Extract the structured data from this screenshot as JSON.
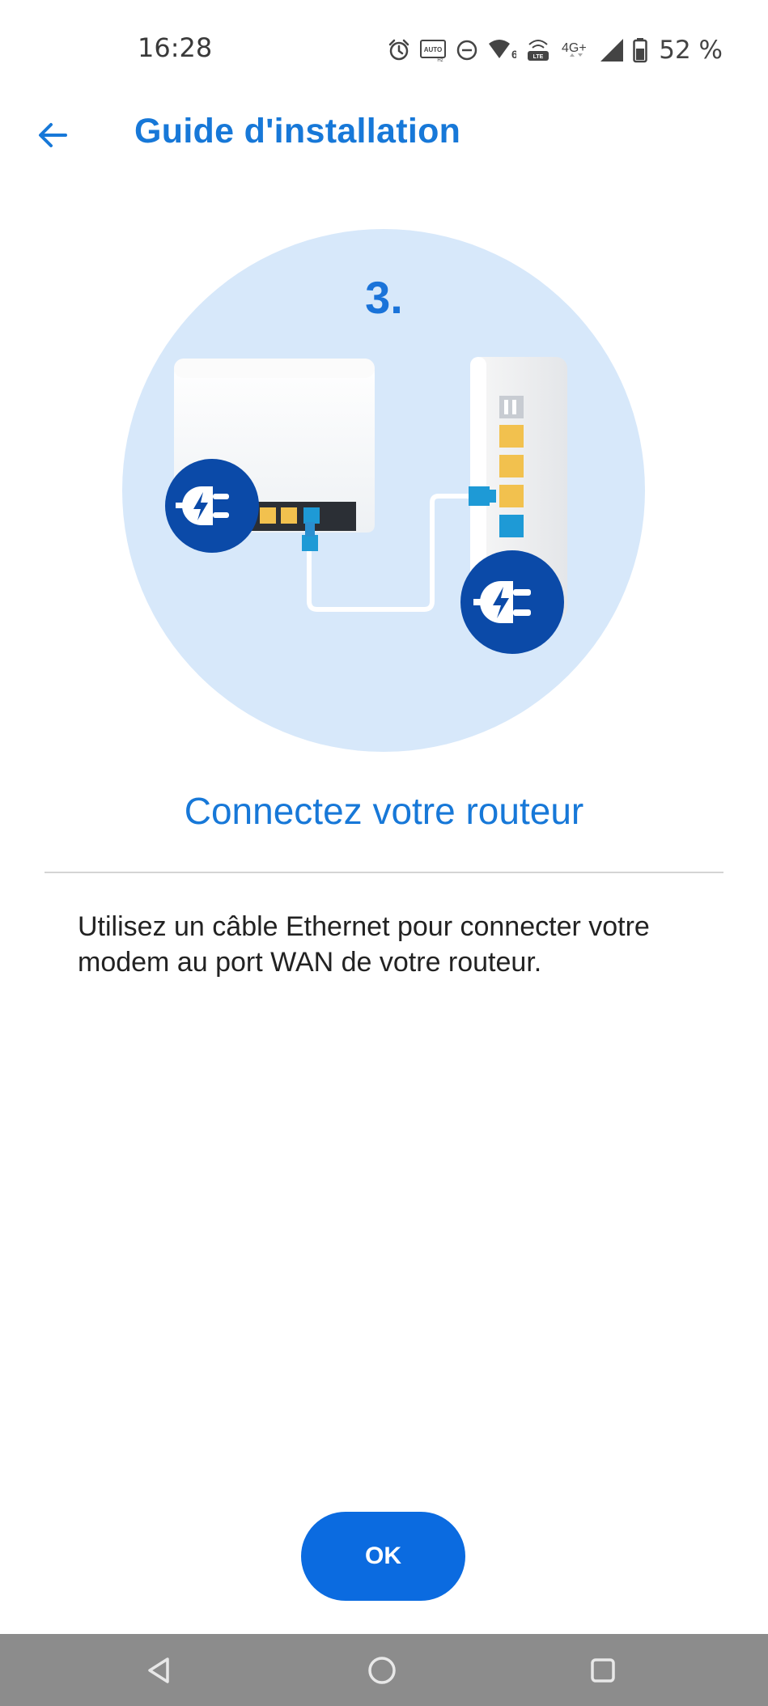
{
  "status_bar": {
    "time": "16:28",
    "battery_percent": "52 %",
    "icons": [
      "alarm-icon",
      "auto-hz-icon",
      "do-not-disturb-icon",
      "wifi-6-icon",
      "volte-icon",
      "4g-icon",
      "signal-icon",
      "battery-icon"
    ],
    "auto_label": "AUTO",
    "hz_label": "Hz",
    "wifi_label": "6",
    "volte_label": "VoLTE",
    "network_label": "4G+"
  },
  "app_bar": {
    "title": "Guide d'installation",
    "back_icon": "arrow-back-icon"
  },
  "step": {
    "number": "3.",
    "title": "Connectez votre routeur",
    "description": "Utilisez un câble Ethernet pour connecter votre modem au port WAN de votre routeur."
  },
  "actions": {
    "ok_label": "OK"
  },
  "nav_bar": {
    "items": [
      "back-triangle-icon",
      "home-circle-icon",
      "recents-square-icon"
    ]
  },
  "colors": {
    "accent": "#1778d8",
    "button": "#0b6be0",
    "illustration_bg": "#d7e8fa",
    "plug_badge": "#0b4aa8",
    "port_yellow": "#f2c14e",
    "port_blue": "#1e9ad6"
  }
}
